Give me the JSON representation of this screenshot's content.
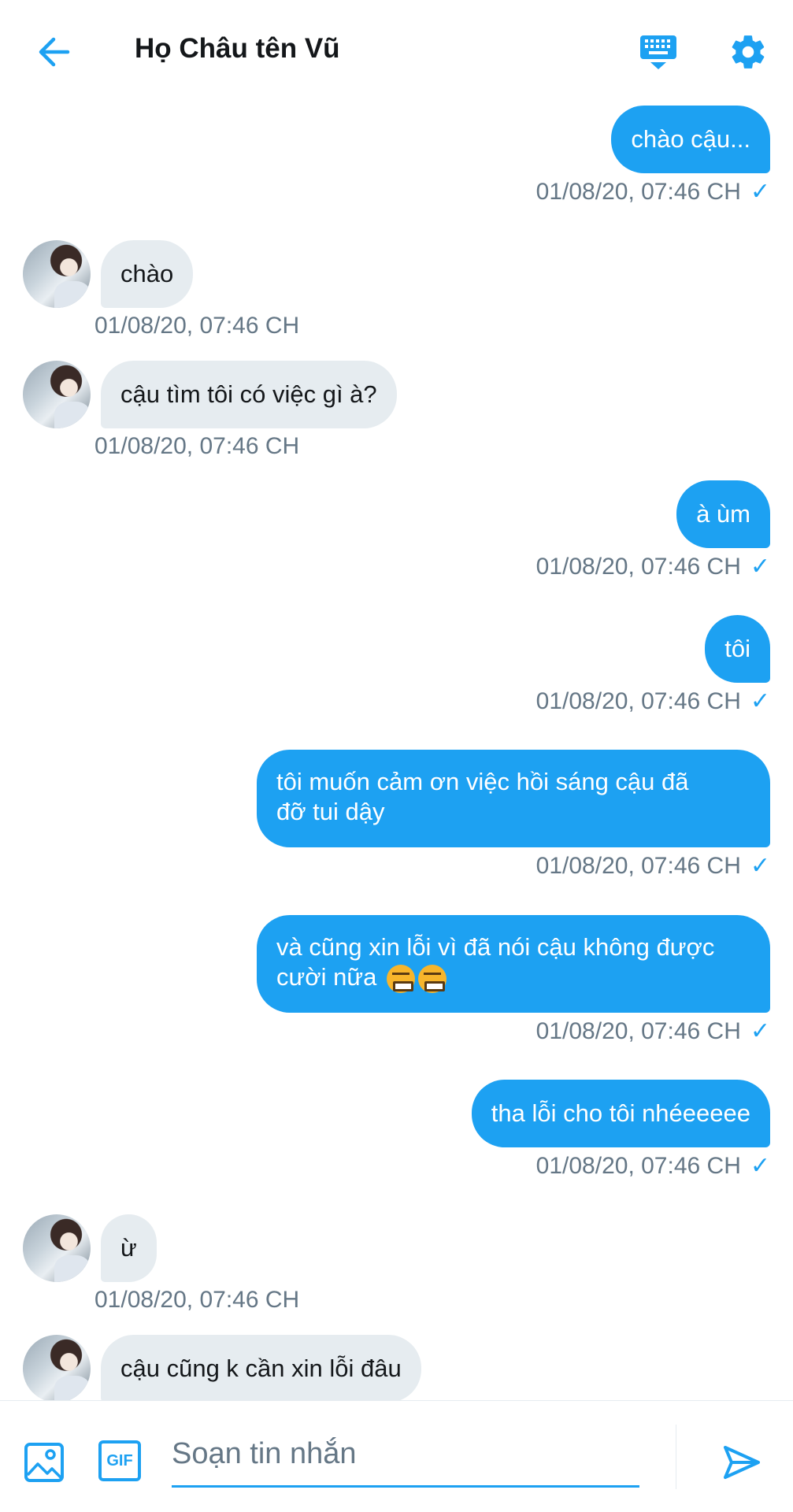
{
  "header": {
    "title": "Họ Châu tên Vũ",
    "back_icon": "arrow-left-icon",
    "keyboard_icon": "keyboard-icon",
    "settings_icon": "gear-icon"
  },
  "messages": [
    {
      "dir": "out",
      "text": "chào cậu...",
      "time": "01/08/20, 07:46 CH",
      "status": "✓"
    },
    {
      "dir": "in",
      "text": "chào",
      "time": "01/08/20, 07:46 CH"
    },
    {
      "dir": "in",
      "text": "cậu tìm tôi có việc gì à?",
      "time": "01/08/20, 07:46 CH"
    },
    {
      "dir": "out",
      "text": "à ùm",
      "time": "01/08/20, 07:46 CH",
      "status": "✓"
    },
    {
      "dir": "out",
      "text": "tôi",
      "time": "01/08/20, 07:46 CH",
      "status": "✓"
    },
    {
      "dir": "out",
      "line1": "tôi muốn cảm ơn việc hồi sáng cậu đã",
      "line2": "đỡ tui dậy",
      "time": "01/08/20, 07:46 CH",
      "status": "✓"
    },
    {
      "dir": "out",
      "line1": "và cũng xin lỗi vì đã nói cậu không được",
      "line2": "cười nữa",
      "emoji": "grimacing-squint-emoji",
      "time": "01/08/20, 07:46 CH",
      "status": "✓"
    },
    {
      "dir": "out",
      "text": "tha lỗi cho tôi nhéeeeee",
      "time": "01/08/20, 07:46 CH",
      "status": "✓"
    },
    {
      "dir": "in",
      "text": "ừ",
      "time": "01/08/20, 07:46 CH"
    },
    {
      "dir": "in",
      "text": "cậu cũng k cần xin lỗi đâu"
    }
  ],
  "composer": {
    "placeholder": "Soạn tin nhắn",
    "image_icon": "image-icon",
    "gif_label": "GIF",
    "send_icon": "send-icon"
  },
  "colors": {
    "accent": "#1da1f2",
    "incoming_bubble": "#e6ecf0",
    "timestamp": "#657786"
  }
}
